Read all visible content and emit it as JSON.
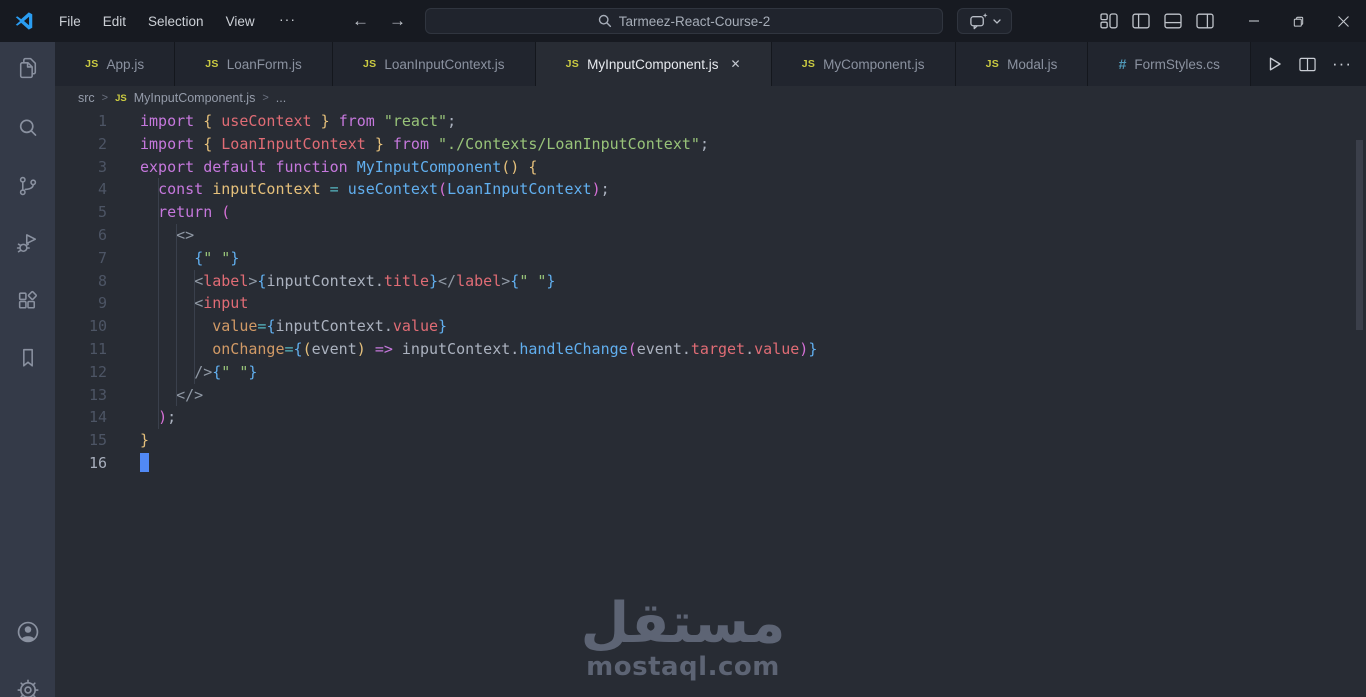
{
  "titlebar": {
    "menus": [
      "File",
      "Edit",
      "Selection",
      "View"
    ],
    "search_text": "Tarmeez-React-Course-2"
  },
  "glyphs": {
    "more": "···",
    "back": "←",
    "forward": "→",
    "ellipsis": "···",
    "breadcrumb_sep": ">",
    "close_tab": "✕"
  },
  "tabs": [
    {
      "label": "App.js",
      "icon": "js",
      "active": false
    },
    {
      "label": "LoanForm.js",
      "icon": "js",
      "active": false
    },
    {
      "label": "LoanInputContext.js",
      "icon": "js",
      "active": false
    },
    {
      "label": "MyInputComponent.js",
      "icon": "js",
      "active": true
    },
    {
      "label": "MyComponent.js",
      "icon": "js",
      "active": false
    },
    {
      "label": "Modal.js",
      "icon": "js",
      "active": false
    },
    {
      "label": "FormStyles.cs",
      "icon": "css",
      "active": false
    }
  ],
  "tab_icons": {
    "js": "JS",
    "css": "#"
  },
  "breadcrumb": {
    "items": [
      "src",
      "MyInputComponent.js",
      "..."
    ]
  },
  "activity_bar": [
    "explorer",
    "search",
    "source-control",
    "run-and-debug",
    "extensions",
    "bookmarks",
    "accounts",
    "settings"
  ],
  "editor_actions": [
    "run",
    "split-editor",
    "more-actions"
  ],
  "palette": {
    "kw": "#c678dd",
    "red": "#e06c75",
    "green": "#98c379",
    "gold": "#e5c07b",
    "orange": "#d19a66",
    "blue": "#61afef",
    "cyan": "#56b6c2",
    "fg": "#abb2bf",
    "pink": "#d670d6",
    "punc": "#9099a5"
  },
  "editor": {
    "active_line": 16,
    "cursor_line": 16,
    "lines": [
      [
        [
          "import ",
          "kw"
        ],
        [
          "{",
          "gold"
        ],
        [
          " ",
          "fg"
        ],
        [
          "useContext",
          "red"
        ],
        [
          " ",
          "fg"
        ],
        [
          "}",
          "gold"
        ],
        [
          " ",
          "fg"
        ],
        [
          "from ",
          "kw"
        ],
        [
          "\"react\"",
          "green"
        ],
        [
          ";",
          "fg"
        ]
      ],
      [
        [
          "import ",
          "kw"
        ],
        [
          "{",
          "gold"
        ],
        [
          " ",
          "fg"
        ],
        [
          "LoanInputContext",
          "red"
        ],
        [
          " ",
          "fg"
        ],
        [
          "}",
          "gold"
        ],
        [
          " ",
          "fg"
        ],
        [
          "from ",
          "kw"
        ],
        [
          "\"./Contexts/LoanInputContext\"",
          "green"
        ],
        [
          ";",
          "fg"
        ]
      ],
      [
        [
          "export default function ",
          "kw"
        ],
        [
          "MyInputComponent",
          "blue"
        ],
        [
          "()",
          "gold"
        ],
        [
          " ",
          "fg"
        ],
        [
          "{",
          "gold"
        ]
      ],
      [
        [
          "  ",
          "fg"
        ],
        [
          "const ",
          "kw"
        ],
        [
          "inputContext",
          "gold"
        ],
        [
          " ",
          "fg"
        ],
        [
          "=",
          "cyan"
        ],
        [
          " ",
          "fg"
        ],
        [
          "useContext",
          "blue"
        ],
        [
          "(",
          "pink"
        ],
        [
          "LoanInputContext",
          "blue"
        ],
        [
          ")",
          "pink"
        ],
        [
          ";",
          "fg"
        ]
      ],
      [
        [
          "  ",
          "fg"
        ],
        [
          "return ",
          "kw"
        ],
        [
          "(",
          "pink"
        ]
      ],
      [
        [
          "    ",
          "fg"
        ],
        [
          "<>",
          "punc"
        ]
      ],
      [
        [
          "      ",
          "fg"
        ],
        [
          "{",
          "blue"
        ],
        [
          "\" \"",
          "green"
        ],
        [
          "}",
          "blue"
        ]
      ],
      [
        [
          "      ",
          "fg"
        ],
        [
          "<",
          "punc"
        ],
        [
          "label",
          "red"
        ],
        [
          ">",
          "punc"
        ],
        [
          "{",
          "blue"
        ],
        [
          "inputContext",
          "fg"
        ],
        [
          ".",
          "fg"
        ],
        [
          "title",
          "red"
        ],
        [
          "}",
          "blue"
        ],
        [
          "</",
          "punc"
        ],
        [
          "label",
          "red"
        ],
        [
          ">",
          "punc"
        ],
        [
          "{",
          "blue"
        ],
        [
          "\" \"",
          "green"
        ],
        [
          "}",
          "blue"
        ]
      ],
      [
        [
          "      ",
          "fg"
        ],
        [
          "<",
          "punc"
        ],
        [
          "input",
          "red"
        ]
      ],
      [
        [
          "        ",
          "fg"
        ],
        [
          "value",
          "orange"
        ],
        [
          "=",
          "cyan"
        ],
        [
          "{",
          "blue"
        ],
        [
          "inputContext",
          "fg"
        ],
        [
          ".",
          "fg"
        ],
        [
          "value",
          "red"
        ],
        [
          "}",
          "blue"
        ]
      ],
      [
        [
          "        ",
          "fg"
        ],
        [
          "onChange",
          "orange"
        ],
        [
          "=",
          "cyan"
        ],
        [
          "{",
          "blue"
        ],
        [
          "(",
          "gold"
        ],
        [
          "event",
          "fg"
        ],
        [
          ")",
          "gold"
        ],
        [
          " ",
          "fg"
        ],
        [
          "=>",
          "kw"
        ],
        [
          " ",
          "fg"
        ],
        [
          "inputContext",
          "fg"
        ],
        [
          ".",
          "fg"
        ],
        [
          "handleChange",
          "blue"
        ],
        [
          "(",
          "pink"
        ],
        [
          "event",
          "fg"
        ],
        [
          ".",
          "fg"
        ],
        [
          "target",
          "red"
        ],
        [
          ".",
          "fg"
        ],
        [
          "value",
          "red"
        ],
        [
          ")",
          "pink"
        ],
        [
          "}",
          "blue"
        ]
      ],
      [
        [
          "      ",
          "fg"
        ],
        [
          "/>",
          "punc"
        ],
        [
          "{",
          "blue"
        ],
        [
          "\" \"",
          "green"
        ],
        [
          "}",
          "blue"
        ]
      ],
      [
        [
          "    ",
          "fg"
        ],
        [
          "</>",
          "punc"
        ]
      ],
      [
        [
          "  ",
          "fg"
        ],
        [
          ")",
          "pink"
        ],
        [
          ";",
          "fg"
        ]
      ],
      [
        [
          "}",
          "gold"
        ]
      ],
      []
    ]
  },
  "watermark": {
    "arabic": "مستقل",
    "latin": "mostaql.com"
  }
}
